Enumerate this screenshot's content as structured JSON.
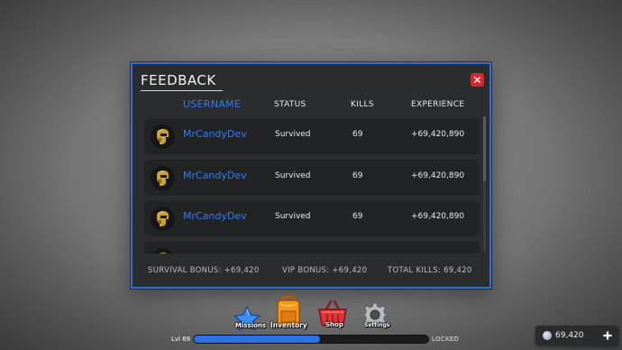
{
  "panel": {
    "title": "FEEDBACK",
    "accent_color": "#2f6fd6",
    "close_icon": "close-icon",
    "columns": {
      "username": "USERNAME",
      "status": "STATUS",
      "kills": "KILLS",
      "experience": "EXPERIENCE"
    },
    "rows": [
      {
        "avatar_icon": "helmet-avatar-icon",
        "username": "MrCandyDev",
        "status": "Survived",
        "kills": "69",
        "experience": "+69,420,890"
      },
      {
        "avatar_icon": "helmet-avatar-icon",
        "username": "MrCandyDev",
        "status": "Survived",
        "kills": "69",
        "experience": "+69,420,890"
      },
      {
        "avatar_icon": "helmet-avatar-icon",
        "username": "MrCandyDev",
        "status": "Survived",
        "kills": "69",
        "experience": "+69,420,890"
      }
    ],
    "footer": {
      "survival_bonus": "SURVIVAL BONUS: +69,420",
      "vip_bonus": "VIP BONUS: +69,420",
      "total_kills": "TOTAL KILLS: 69,420"
    }
  },
  "hud": {
    "buttons": [
      {
        "label": "Missions",
        "icon": "star-icon"
      },
      {
        "label": "Inventory",
        "icon": "backpack-icon"
      },
      {
        "label": "Shop",
        "icon": "basket-icon"
      },
      {
        "label": "Settings",
        "icon": "gear-icon"
      }
    ],
    "level_label": "Lvl 69",
    "xp_progress": 0.54,
    "xp_color": "#2f6fe8",
    "locked_label": "LOCKED",
    "currency_value": "69,420",
    "currency_icon": "coin-icon",
    "add_icon": "plus-icon"
  }
}
